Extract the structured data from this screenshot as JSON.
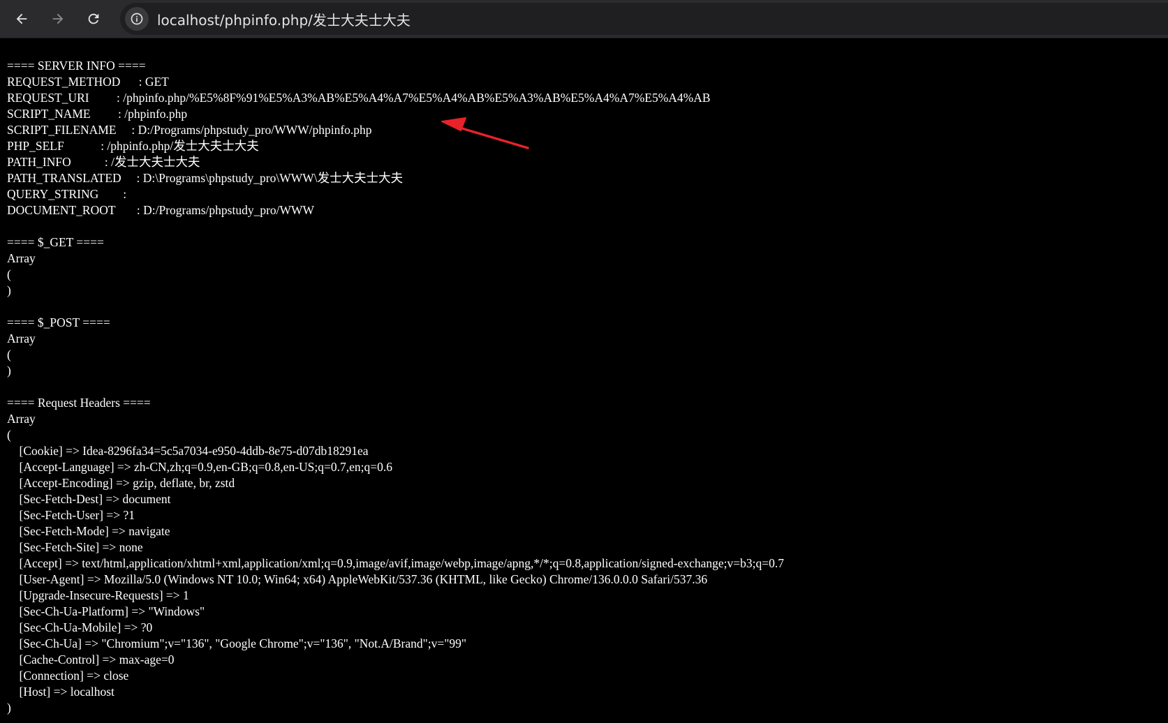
{
  "browser": {
    "url": "localhost/phpinfo.php/发士大夫士大夫",
    "icons": {
      "back": "arrow-left-icon",
      "forward": "arrow-right-icon",
      "reload": "reload-icon",
      "site_info": "info-icon"
    }
  },
  "page": {
    "lines": [
      "==== SERVER INFO ====",
      "REQUEST_METHOD      : GET",
      "REQUEST_URI         : /phpinfo.php/%E5%8F%91%E5%A3%AB%E5%A4%A7%E5%A4%AB%E5%A3%AB%E5%A4%A7%E5%A4%AB",
      "SCRIPT_NAME         : /phpinfo.php",
      "SCRIPT_FILENAME     : D:/Programs/phpstudy_pro/WWW/phpinfo.php",
      "PHP_SELF            : /phpinfo.php/发士大夫士大夫",
      "PATH_INFO           : /发士大夫士大夫",
      "PATH_TRANSLATED     : D:\\Programs\\phpstudy_pro\\WWW\\发士大夫士大夫",
      "QUERY_STRING        :",
      "DOCUMENT_ROOT       : D:/Programs/phpstudy_pro/WWW",
      "",
      "==== $_GET ====",
      "Array",
      "(",
      ")",
      "",
      "==== $_POST ====",
      "Array",
      "(",
      ")",
      "",
      "==== Request Headers ====",
      "Array",
      "(",
      "    [Cookie] => Idea-8296fa34=5c5a7034-e950-4ddb-8e75-d07db18291ea",
      "    [Accept-Language] => zh-CN,zh;q=0.9,en-GB;q=0.8,en-US;q=0.7,en;q=0.6",
      "    [Accept-Encoding] => gzip, deflate, br, zstd",
      "    [Sec-Fetch-Dest] => document",
      "    [Sec-Fetch-User] => ?1",
      "    [Sec-Fetch-Mode] => navigate",
      "    [Sec-Fetch-Site] => none",
      "    [Accept] => text/html,application/xhtml+xml,application/xml;q=0.9,image/avif,image/webp,image/apng,*/*;q=0.8,application/signed-exchange;v=b3;q=0.7",
      "    [User-Agent] => Mozilla/5.0 (Windows NT 10.0; Win64; x64) AppleWebKit/537.36 (KHTML, like Gecko) Chrome/136.0.0.0 Safari/537.36",
      "    [Upgrade-Insecure-Requests] => 1",
      "    [Sec-Ch-Ua-Platform] => \"Windows\"",
      "    [Sec-Ch-Ua-Mobile] => ?0",
      "    [Sec-Ch-Ua] => \"Chromium\";v=\"136\", \"Google Chrome\";v=\"136\", \"Not.A/Brand\";v=\"99\"",
      "    [Cache-Control] => max-age=0",
      "    [Connection] => close",
      "    [Host] => localhost",
      ")"
    ]
  },
  "annotation": {
    "icon": "red-arrow-icon",
    "color": "#e8222a"
  },
  "colors": {
    "toolbar_bg": "#2b2b2d",
    "omnibox_bg": "#1f1f21",
    "page_bg": "#000000",
    "text": "#ffffff"
  }
}
